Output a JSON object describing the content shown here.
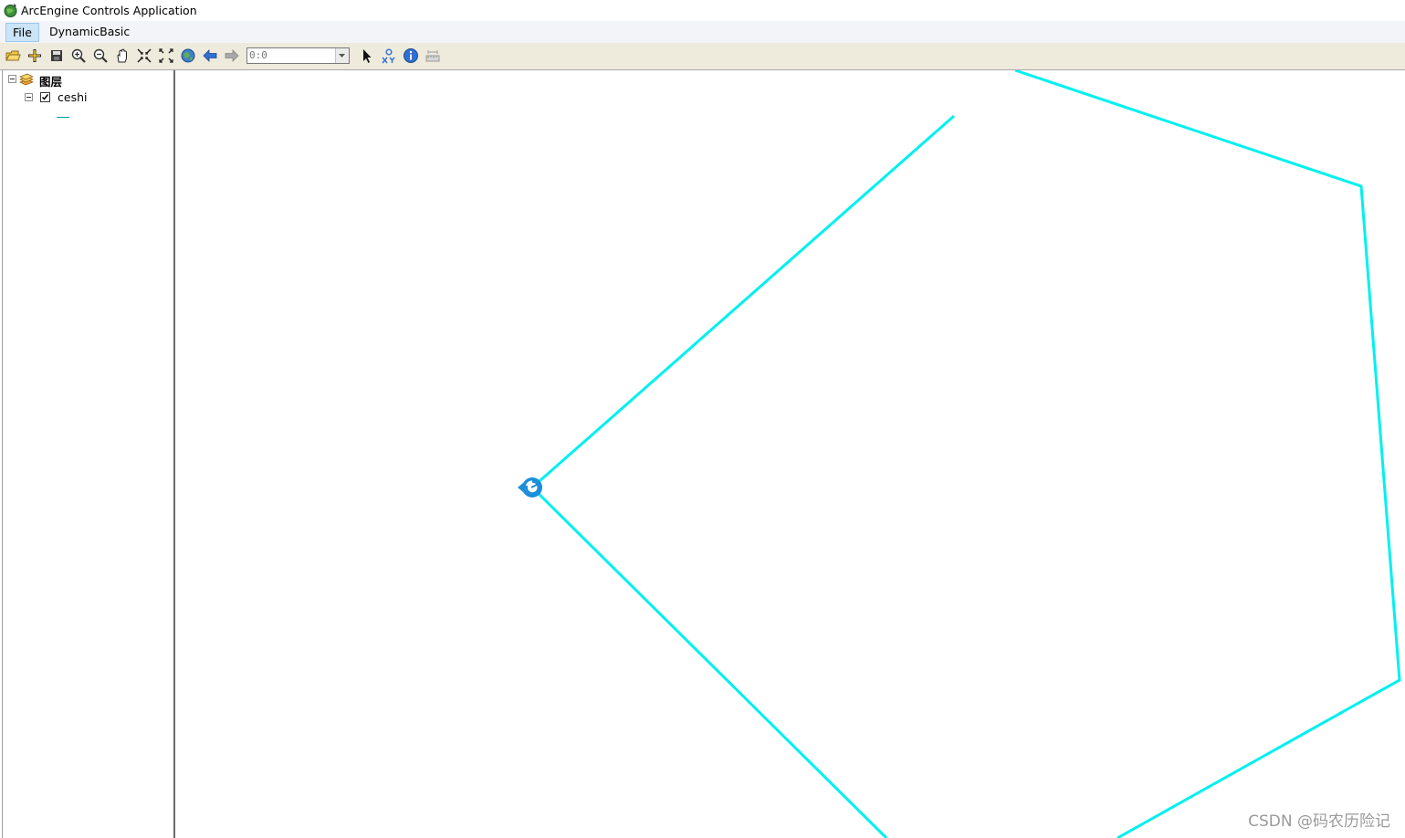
{
  "window": {
    "title": "ArcEngine Controls Application",
    "icon": "globe-app-icon"
  },
  "menu": {
    "items": [
      {
        "label": "File"
      },
      {
        "label": "DynamicBasic"
      }
    ]
  },
  "toolbar": {
    "buttons": [
      {
        "name": "open-document-icon"
      },
      {
        "name": "add-data-icon"
      },
      {
        "name": "save-icon"
      },
      {
        "name": "zoom-in-icon"
      },
      {
        "name": "zoom-out-icon"
      },
      {
        "name": "pan-icon"
      },
      {
        "name": "fixed-zoom-in-icon"
      },
      {
        "name": "fixed-zoom-out-icon"
      },
      {
        "name": "full-extent-icon"
      },
      {
        "name": "back-icon"
      },
      {
        "name": "forward-icon"
      },
      {
        "name": "select-arrow-icon"
      },
      {
        "name": "go-to-xy-icon"
      },
      {
        "name": "identify-icon"
      },
      {
        "name": "measure-icon"
      }
    ],
    "scale_value": "0:0"
  },
  "toc": {
    "root_label": "图层",
    "layer": {
      "label": "ceshi",
      "checked": true
    },
    "legend_color": "#00a1a1"
  },
  "map": {
    "line_color": "#00f0f0",
    "marker_color": "#1a8fd8"
  },
  "watermark": "CSDN @码农历险记"
}
